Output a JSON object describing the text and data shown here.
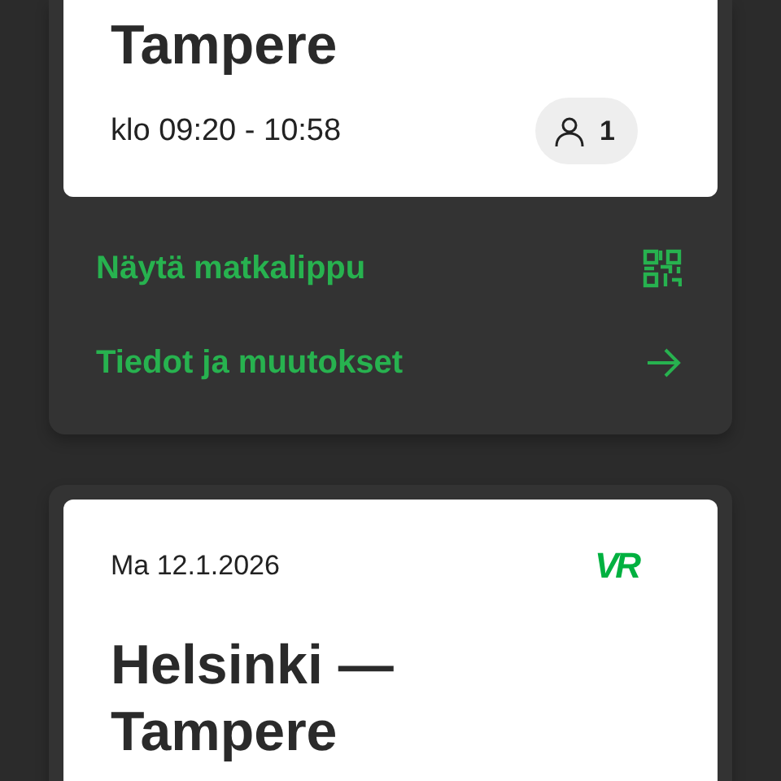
{
  "trips": [
    {
      "title": "Tampere",
      "time": "klo 09:20 - 10:58",
      "passengers": "1",
      "actions": [
        {
          "kind": "ticket",
          "label": "Näytä matkalippu"
        },
        {
          "kind": "details",
          "label": "Tiedot ja muutokset"
        }
      ]
    },
    {
      "date": "Ma 12.1.2026",
      "logo": "VR",
      "title": "Helsinki —\nTampere"
    }
  ]
}
